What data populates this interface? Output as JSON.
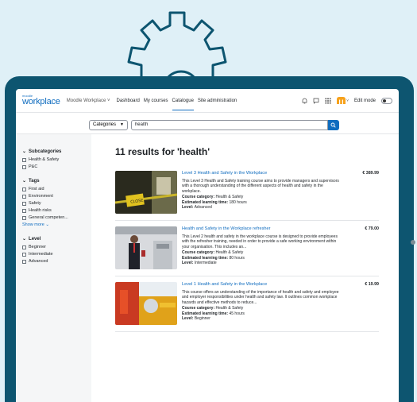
{
  "brand": {
    "logo_small": "moodle",
    "logo_big": "workplace",
    "app_menu": "Moodle Workplace"
  },
  "nav": {
    "items": [
      "Dashboard",
      "My courses",
      "Catalogue",
      "Site administration"
    ],
    "active": "Catalogue",
    "edit_mode_label": "Edit mode"
  },
  "search": {
    "category_select": "Categories",
    "query": "health"
  },
  "sidebar": {
    "subcategories": {
      "title": "Subcategories",
      "items": [
        "Health & Safety",
        "P&C"
      ]
    },
    "tags": {
      "title": "Tags",
      "items": [
        "First aid",
        "Environment",
        "Safety",
        "Health risks",
        "General competen..."
      ],
      "show_more": "Show more"
    },
    "level": {
      "title": "Level",
      "items": [
        "Beginner",
        "Intermediate",
        "Advanced"
      ]
    }
  },
  "results": {
    "heading": "11 results for 'health'",
    "courses": [
      {
        "title": "Level 3 Health and Safety in the Workplace",
        "price": "€ 389.99",
        "description": "This Level 3 Health and Safety training course aims to provide managers and supervisors with a thorough understanding of the different aspects of health and safety in the workplace.",
        "category_label": "Course category:",
        "category": "Health & Safety",
        "time_label": "Estimated learning time:",
        "time": "180 hours",
        "level_label": "Level:",
        "level": "Advanced"
      },
      {
        "title": "Health and Safety in the Workplace refresher",
        "price": "€ 79.00",
        "description": "This Level 2 health and safety in the workplace course is designed to provide employees with the refresher training, needed in order to provide a safe working environment within your organisation. This includes an...",
        "category_label": "Course category:",
        "category": "Health & Safety",
        "time_label": "Estimated learning time:",
        "time": "80 hours",
        "level_label": "Level:",
        "level": "Intermediate"
      },
      {
        "title": "Level 1 Health and Safety in the Workplace",
        "price": "€ 19.99",
        "description": "This course offers an understanding of the importance of health and safety and employee and employer responsibilities under health and safety law. It outlines common workplace hazards and effective methods to reduce...",
        "category_label": "Course category:",
        "category": "Health & Safety",
        "time_label": "Estimated learning time:",
        "time": "45 hours",
        "level_label": "Level:",
        "level": "Beginner"
      }
    ]
  },
  "colors": {
    "accent": "#0f6cbf",
    "device_frame": "#0d5570",
    "background": "#dff0f7"
  }
}
